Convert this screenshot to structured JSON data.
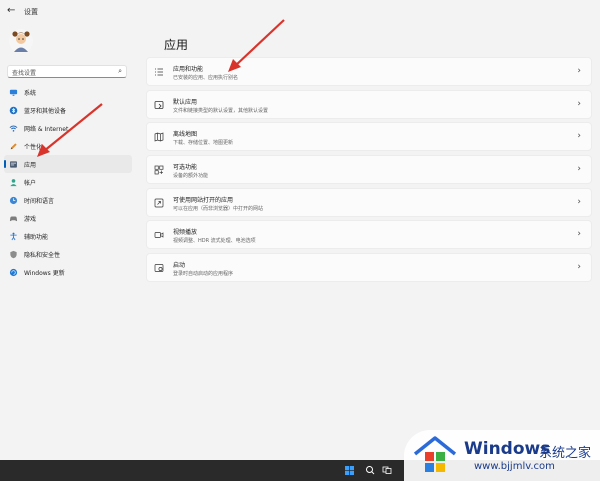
{
  "window": {
    "title": "设置"
  },
  "search": {
    "placeholder": "查找设置"
  },
  "sidebar": {
    "items": [
      {
        "label": "系统",
        "icon": "monitor-icon"
      },
      {
        "label": "蓝牙和其他设备",
        "icon": "bluetooth-icon"
      },
      {
        "label": "网络 & Internet",
        "icon": "wifi-icon"
      },
      {
        "label": "个性化",
        "icon": "pencil-icon"
      },
      {
        "label": "应用",
        "icon": "apps-icon",
        "selected": true
      },
      {
        "label": "帐户",
        "icon": "person-icon"
      },
      {
        "label": "时间和语言",
        "icon": "globe-clock-icon"
      },
      {
        "label": "游戏",
        "icon": "gamepad-icon"
      },
      {
        "label": "辅助功能",
        "icon": "accessibility-icon"
      },
      {
        "label": "隐私和安全性",
        "icon": "shield-icon"
      },
      {
        "label": "Windows 更新",
        "icon": "update-icon"
      }
    ]
  },
  "main": {
    "title": "应用",
    "cards": [
      {
        "title": "应用和功能",
        "desc": "已安装的应用、应用执行别名",
        "icon": "list-icon"
      },
      {
        "title": "默认应用",
        "desc": "文件和链接类型的默认设置，其他默认设置",
        "icon": "default-apps-icon"
      },
      {
        "title": "离线地图",
        "desc": "下载、存储位置、地图更新",
        "icon": "map-icon"
      },
      {
        "title": "可选功能",
        "desc": "设备的额外功能",
        "icon": "optional-features-icon"
      },
      {
        "title": "可使用网站打开的应用",
        "desc": "可以在应用（而非浏览器）中打开的网站",
        "icon": "web-apps-icon"
      },
      {
        "title": "视频播放",
        "desc": "视频调整、HDR 流式处理、电池选项",
        "icon": "video-icon"
      },
      {
        "title": "启动",
        "desc": "登录时自动启动的应用程序",
        "icon": "startup-icon"
      }
    ]
  },
  "watermark": {
    "brand": "Windows",
    "brand_cn": "系统之家",
    "url": "www.bjjmlv.com"
  },
  "colors": {
    "accent": "#005fb8",
    "arrow": "#d9342b",
    "taskbar": "#2a2a2a"
  }
}
